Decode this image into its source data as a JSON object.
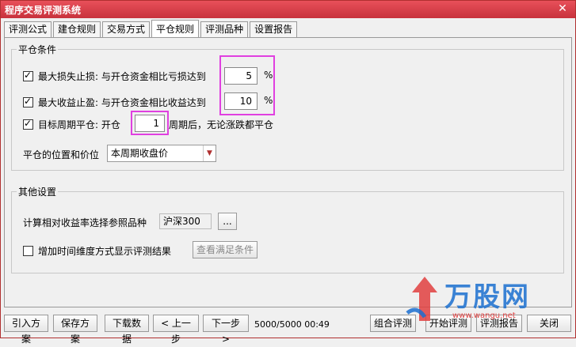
{
  "window": {
    "title": "程序交易评测系统",
    "close_glyph": "✕"
  },
  "tabs": [
    "评测公式",
    "建仓规则",
    "交易方式",
    "平仓规则",
    "评测品种",
    "设置报告"
  ],
  "active_tab": 3,
  "close_group": {
    "label": "平仓条件",
    "stop_loss": {
      "checked": true,
      "label": "最大损失止损: 与开仓资金相比亏损达到",
      "value": "5",
      "unit": "%"
    },
    "take_profit": {
      "checked": true,
      "label": "最大收益止盈: 与开仓资金相比收益达到",
      "value": "10",
      "unit": "%"
    },
    "period_close": {
      "checked": true,
      "label_before": "目标周期平仓: 开仓",
      "value": "1",
      "label_after": "周期后，无论涨跌都平仓"
    },
    "price": {
      "label": "平仓的位置和价位",
      "selected": "本周期收盘价"
    }
  },
  "other_group": {
    "label": "其他设置",
    "ref_label": "计算相对收益率选择参照品种",
    "ref_value": "沪深300",
    "browse_label": "...",
    "time_dim": {
      "checked": false,
      "label": "增加时间维度方式显示评测结果"
    },
    "view_button": "查看满足条件"
  },
  "bottom": {
    "import": "引入方案",
    "save": "保存方案",
    "download": "下载数据",
    "prev": "< 上一步",
    "next": "下一步 >",
    "status": "5000/5000 00:49",
    "combo": "组合评测",
    "start": "开始评测",
    "report": "评测报告",
    "close": "关闭"
  },
  "watermark": {
    "brand": "万股网",
    "url": "www.wangu.net"
  },
  "colors": {
    "titlebar": "#d8404a",
    "highlight": "#e040e0",
    "brand": "#1b6fd0"
  }
}
